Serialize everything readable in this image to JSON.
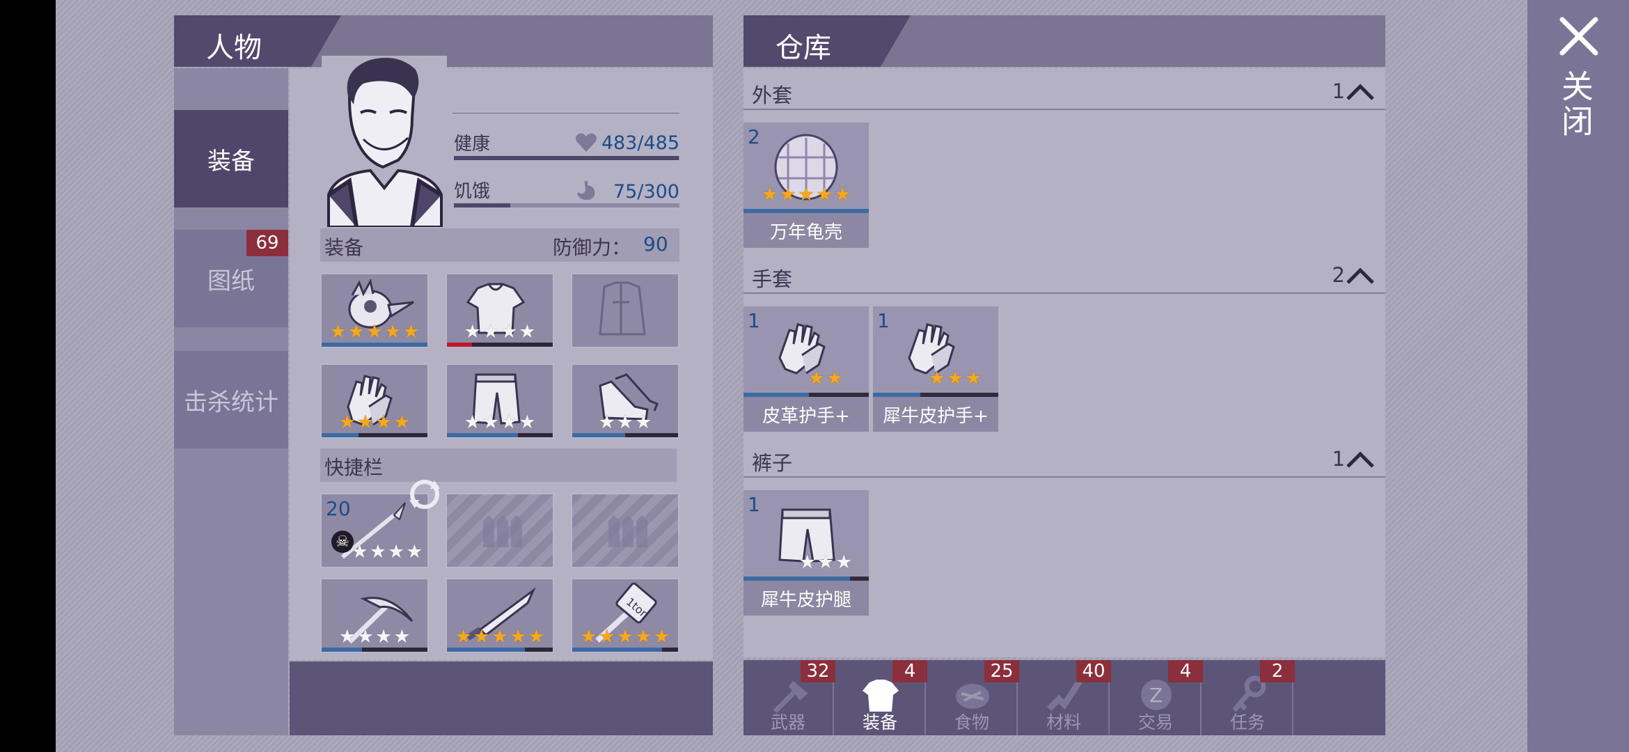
{
  "close": {
    "label": "关闭"
  },
  "character": {
    "title": "人物",
    "tabs": [
      {
        "label": "装备",
        "active": true
      },
      {
        "label": "图纸",
        "badge": "69"
      },
      {
        "label": "击杀统计"
      }
    ],
    "stats": [
      {
        "label": "健康",
        "icon": "heart-icon",
        "value": "483/485",
        "fraction": 0.996
      },
      {
        "label": "饥饿",
        "icon": "stomach-icon",
        "value": "75/300",
        "fraction": 0.25
      }
    ],
    "equipment_header": "装备",
    "defense_label": "防御力：",
    "defense_value": "90",
    "equipment_slots": [
      {
        "icon": "bird-helmet-icon",
        "stars": 5,
        "star_color": "gold",
        "durability": 1.0,
        "durability_color": "#3e6aa3"
      },
      {
        "icon": "shirt-icon",
        "stars": 4,
        "star_color": "white",
        "durability": 0.24,
        "durability_color": "#c0182a"
      },
      {
        "icon": "jacket-icon",
        "stars": 0,
        "durability": 0
      },
      {
        "icon": "gloves-icon",
        "stars": 4,
        "star_color": "gold",
        "durability": 0.35,
        "durability_color": "#3e6aa3"
      },
      {
        "icon": "pants-icon",
        "stars": 4,
        "star_color": "white",
        "durability": 0.67,
        "durability_color": "#3e6aa3"
      },
      {
        "icon": "sneakers-icon",
        "stars": 3,
        "star_color": "white",
        "durability": 0.5,
        "durability_color": "#3e6aa3"
      }
    ],
    "quickbar_header": "快捷栏",
    "quick_slots": [
      {
        "icon": "spear-icon",
        "count": "20",
        "stars": 4,
        "star_color": "white",
        "empty": false,
        "poison": true
      },
      {
        "icon": "empty-slot-icon",
        "empty": true
      },
      {
        "icon": "empty-slot-icon",
        "empty": true
      },
      {
        "icon": "pickaxe-icon",
        "stars": 4,
        "star_color": "white",
        "empty": false,
        "durability": 0.38
      },
      {
        "icon": "machete-icon",
        "stars": 5,
        "star_color": "gold",
        "empty": false,
        "durability": 0.74
      },
      {
        "icon": "hammer-icon",
        "stars": 5,
        "star_color": "gold",
        "empty": false,
        "durability": 0.85
      }
    ]
  },
  "warehouse": {
    "title": "仓库",
    "categories": [
      {
        "name": "外套",
        "count": "1",
        "items": [
          {
            "qty": "2",
            "name": "万年龟壳",
            "icon": "turtle-shell-icon",
            "stars": 5,
            "star_color": "gold",
            "durability": 1.0
          }
        ]
      },
      {
        "name": "手套",
        "count": "2",
        "items": [
          {
            "qty": "1",
            "name": "皮革护手+",
            "icon": "gloves-icon",
            "stars": 2,
            "star_color": "gold",
            "durability": 0.52
          },
          {
            "qty": "1",
            "name": "犀牛皮护手+",
            "icon": "gloves-icon",
            "stars": 3,
            "star_color": "gold",
            "durability": 0.38
          }
        ]
      },
      {
        "name": "裤子",
        "count": "1",
        "items": [
          {
            "qty": "1",
            "name": "犀牛皮护腿",
            "icon": "pants-icon",
            "stars": 3,
            "star_color": "white",
            "durability": 0.85
          }
        ]
      }
    ],
    "bottom_tabs": [
      {
        "label": "武器",
        "badge": "32",
        "icon": "axe-icon",
        "active": false
      },
      {
        "label": "装备",
        "badge": "4",
        "icon": "tshirt-icon",
        "active": true
      },
      {
        "label": "食物",
        "badge": "25",
        "icon": "meat-icon",
        "active": false
      },
      {
        "label": "材料",
        "badge": "40",
        "icon": "material-icon",
        "active": false
      },
      {
        "label": "交易",
        "badge": "4",
        "icon": "coin-icon",
        "active": false
      },
      {
        "label": "任务",
        "badge": "2",
        "icon": "key-icon",
        "active": false
      }
    ]
  }
}
